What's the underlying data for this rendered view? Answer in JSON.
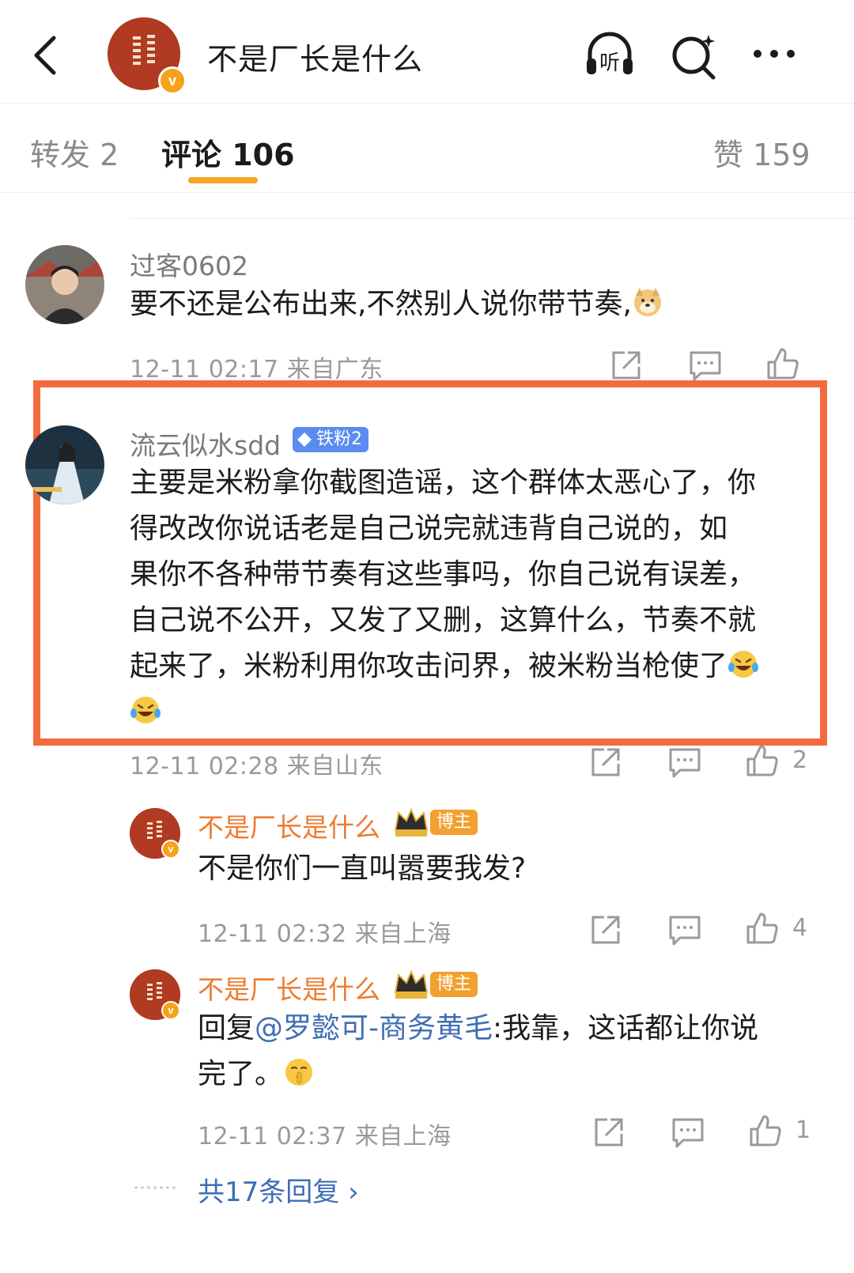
{
  "header": {
    "title": "不是厂长是什么",
    "avatar_seal_text": "安帝于天 乾寿永昌",
    "verified_mark": "v",
    "icons": [
      "back-icon",
      "listen-icon",
      "search-icon",
      "more-icon"
    ],
    "listen_label": "听"
  },
  "tabs": [
    {
      "label": "转发 2",
      "active": false
    },
    {
      "label": "评论 106",
      "active": true
    },
    {
      "label": "赞 159",
      "active": false
    }
  ],
  "comments": [
    {
      "username": "过客0602",
      "text": "要不还是公布出来,不然别人说你带节奏,",
      "emoji": "doge",
      "time": "12-11 02:17",
      "location": "来自广东",
      "likes": ""
    },
    {
      "username": "流云似水sdd",
      "fan_badge": "铁粉2",
      "text_lines": [
        "主要是米粉拿你截图造谣，这个群体太恶心了，你",
        "得改改你说话老是自己说完就违背自己说的，如",
        "果你不各种带节奏有这些事吗，你自己说有误差，",
        "自己说不公开，又发了又删，这算什么，节奏不就",
        "起来了，米粉利用你攻击问界，被米粉当枪使了"
      ],
      "emoji": "laugh-cry",
      "time": "12-11 02:28",
      "location": "来自山东",
      "likes": "2",
      "highlighted": true
    }
  ],
  "replies": [
    {
      "username": "不是厂长是什么",
      "host_badge": "博主",
      "text": "不是你们一直叫嚣要我发?",
      "time": "12-11 02:32",
      "location": "来自上海",
      "likes": "4"
    },
    {
      "username": "不是厂长是什么",
      "host_badge": "博主",
      "reply_prefix": "回复",
      "mention": "@罗懿可-商务黄毛",
      "text_after_mention": ":我靠，这话都让你说",
      "text_line2": "完了。",
      "emoji": "shush",
      "time": "12-11 02:37",
      "location": "来自上海",
      "likes": "1"
    }
  ],
  "more_replies": "共17条回复 ›",
  "colors": {
    "accent_orange": "#f5a623",
    "highlight_border": "#f36b3c",
    "owner_name": "#ee7b2f",
    "link_blue": "#3f6db5",
    "fan_badge_blue": "#5a8cf0",
    "seal_red": "#b03a22"
  }
}
